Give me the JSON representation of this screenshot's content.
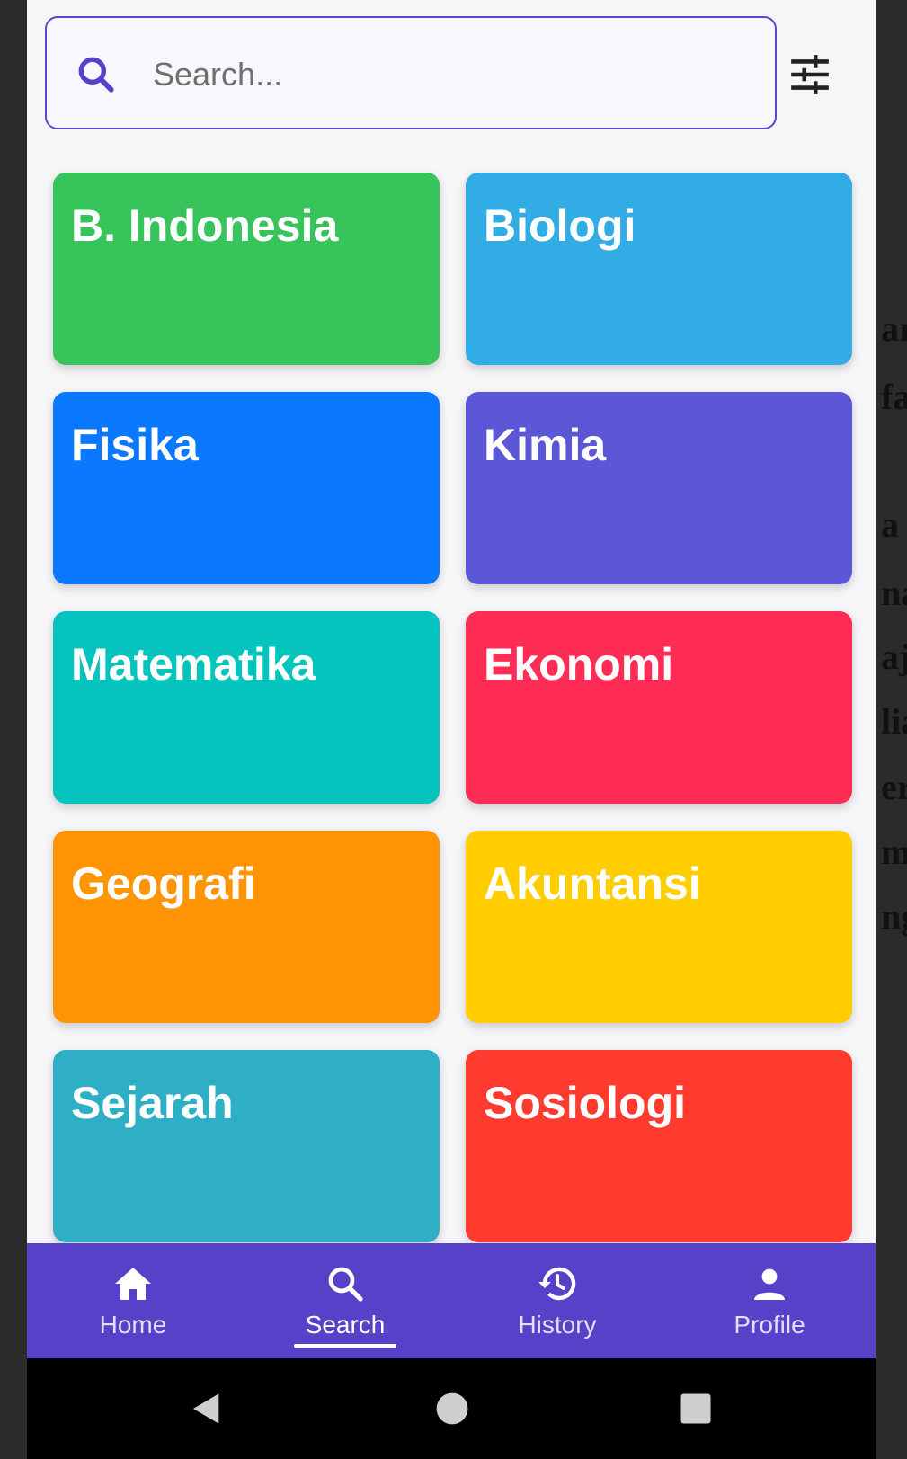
{
  "search": {
    "placeholder": "Search..."
  },
  "subjects": [
    {
      "label": "B. Indonesia",
      "color": "#37c45a"
    },
    {
      "label": "Biologi",
      "color": "#32ace4"
    },
    {
      "label": "Fisika",
      "color": "#0a78ff"
    },
    {
      "label": "Kimia",
      "color": "#5b57d6"
    },
    {
      "label": "Matematika",
      "color": "#05c4bd"
    },
    {
      "label": "Ekonomi",
      "color": "#ff2c56"
    },
    {
      "label": "Geografi",
      "color": "#ff9504"
    },
    {
      "label": "Akuntansi",
      "color": "#ffcd00"
    },
    {
      "label": "Sejarah",
      "color": "#2eafc6"
    },
    {
      "label": "Sosiologi",
      "color": "#ff3b30"
    }
  ],
  "nav": [
    {
      "label": "Home",
      "icon": "home-icon"
    },
    {
      "label": "Search",
      "icon": "search-icon",
      "active": true
    },
    {
      "label": "History",
      "icon": "history-icon"
    },
    {
      "label": "Profile",
      "icon": "person-icon"
    }
  ],
  "colors": {
    "accent": "#5641c8",
    "border": "#5b47c9"
  }
}
